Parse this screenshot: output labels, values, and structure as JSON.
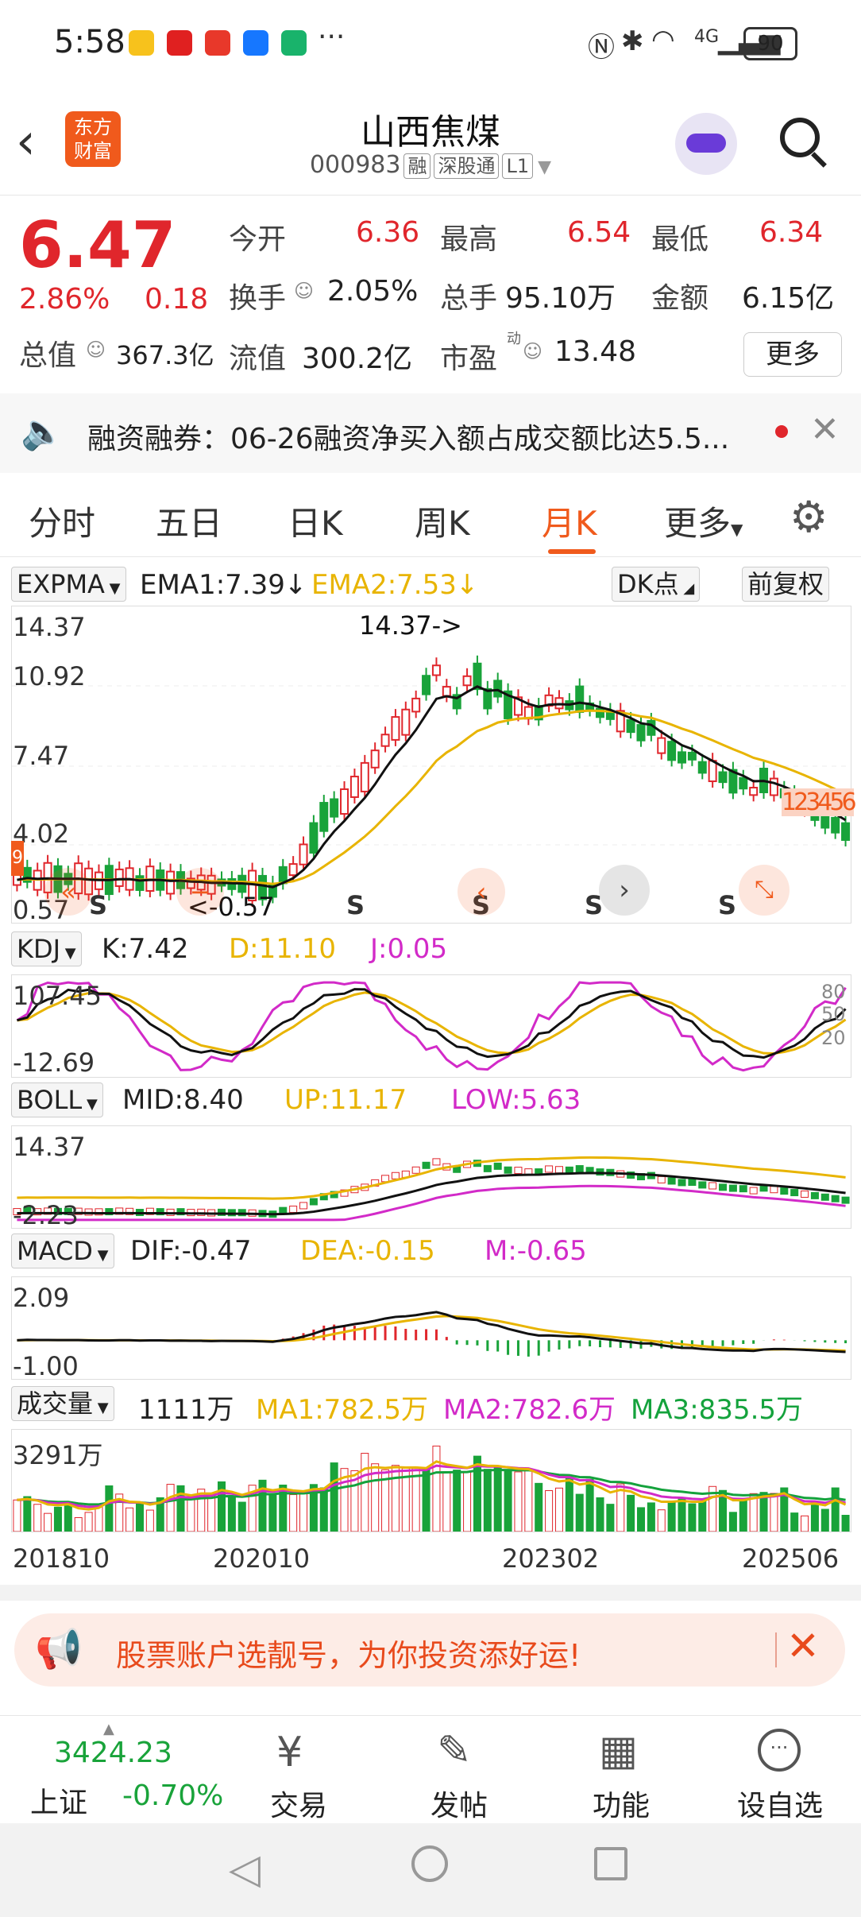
{
  "status_bar": {
    "time": "5:58",
    "battery": "90",
    "network": "4G"
  },
  "header": {
    "title": "山西焦煤",
    "code": "000983",
    "tags": [
      "融",
      "深股通",
      "L1"
    ],
    "logo_text": "东方财富"
  },
  "quote": {
    "price": "6.47",
    "change_pct": "2.86%",
    "change": "0.18",
    "open_label": "今开",
    "open": "6.36",
    "high_label": "最高",
    "high": "6.54",
    "low_label": "最低",
    "low": "6.34",
    "turnover_label": "换手",
    "turnover": "2.05%",
    "volume_label": "总手",
    "volume": "95.10万",
    "amount_label": "金额",
    "amount": "6.15亿",
    "total_cap_label": "总值",
    "total_cap": "367.3亿",
    "float_cap_label": "流值",
    "float_cap": "300.2亿",
    "pe_label": "市盈",
    "pe_sup": "动",
    "pe": "13.48",
    "more_label": "更多"
  },
  "notice": {
    "text": "融资融券：06-26融资净买入额占成交额比达5.5..."
  },
  "tabs": [
    "分时",
    "五日",
    "日K",
    "周K",
    "月K",
    "更多"
  ],
  "active_tab": "月K",
  "chart": {
    "main": {
      "indicator": "EXPMA",
      "ema1": "EMA1:7.39",
      "ema2": "EMA2:7.53",
      "dk_label": "DK点",
      "adj_label": "前复权",
      "y_labels": [
        "14.37",
        "10.92",
        "7.47",
        "4.02",
        "0.57"
      ],
      "max_annot": "14.37->",
      "min_annot": "<-0.57",
      "left_marker": "9",
      "wave_labels": [
        "1",
        "2",
        "3",
        "4",
        "5",
        "6"
      ],
      "signal": "S"
    },
    "kdj": {
      "indicator": "KDJ",
      "k": "K:7.42",
      "d": "D:11.10",
      "j": "J:0.05",
      "y_labels": [
        "107.45",
        "-12.69"
      ],
      "levels": [
        "80",
        "50",
        "20"
      ]
    },
    "boll": {
      "indicator": "BOLL",
      "mid": "MID:8.40",
      "up": "UP:11.17",
      "low": "LOW:5.63",
      "y_labels": [
        "14.37",
        "-2.23"
      ]
    },
    "macd": {
      "indicator": "MACD",
      "dif": "DIF:-0.47",
      "dea": "DEA:-0.15",
      "m": "M:-0.65",
      "y_labels": [
        "2.09",
        "-1.00"
      ]
    },
    "vol": {
      "indicator": "成交量",
      "value": "1111万",
      "ma1": "MA1:782.5万",
      "ma2": "MA2:782.6万",
      "ma3": "MA3:835.5万",
      "y_label": "3291万"
    },
    "x_labels": [
      "201810",
      "202010",
      "202302",
      "202506"
    ],
    "colors": {
      "up": "#e0262c",
      "down": "#19a33a",
      "ema1": "#111111",
      "ema2": "#e8b400",
      "j": "#d22ac8"
    }
  },
  "promo": {
    "text": "股票账户选靓号，为你投资添好运!"
  },
  "bottom_nav": {
    "index_value": "3424.23",
    "index_name": "上证",
    "index_change": "-0.70%",
    "items": [
      "交易",
      "发帖",
      "功能",
      "设自选"
    ]
  }
}
